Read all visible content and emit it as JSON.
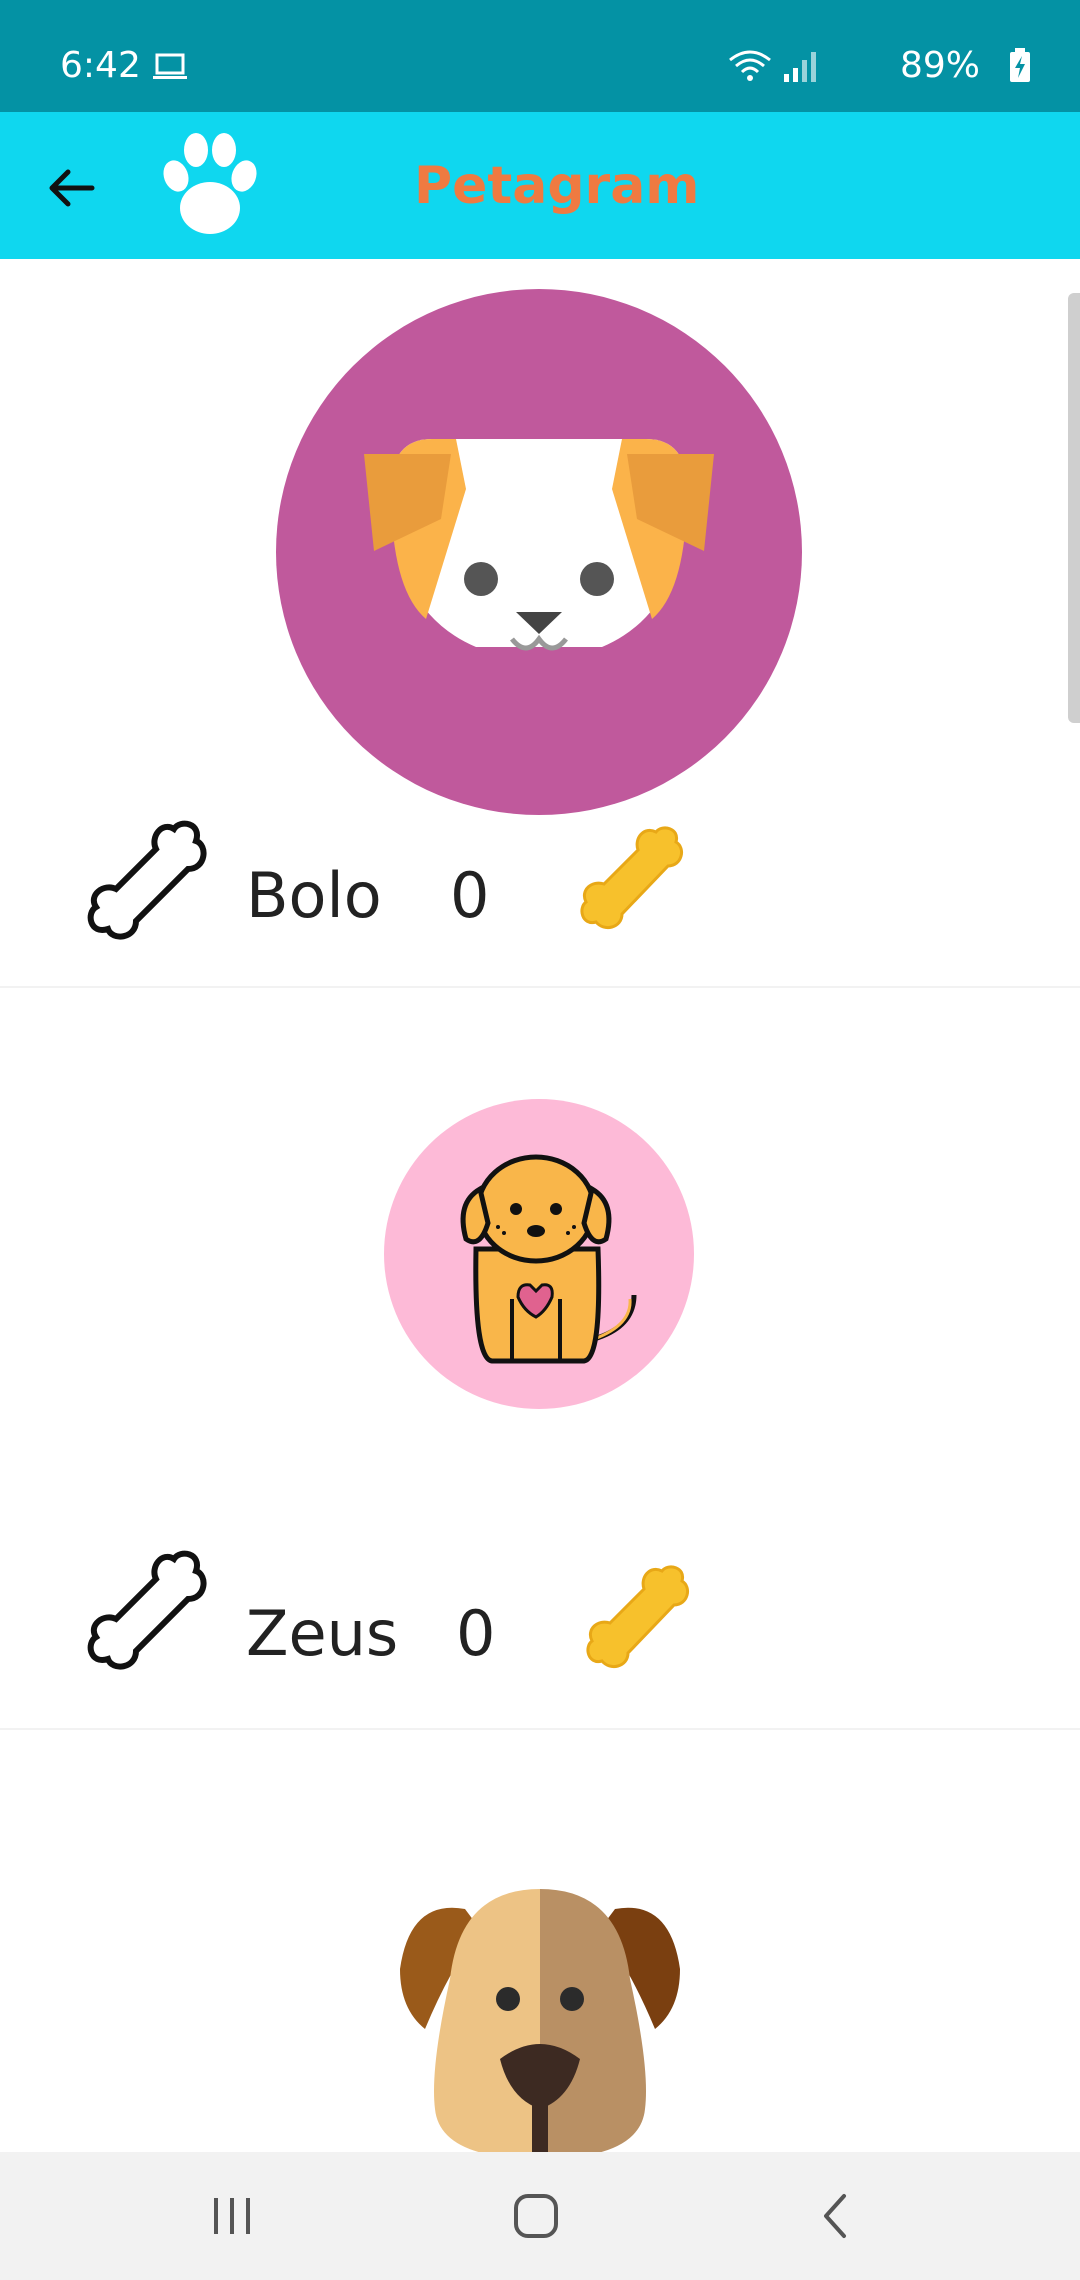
{
  "status_bar": {
    "time": "6:42",
    "battery_percent": "89%",
    "background_color": "#0492a4",
    "icons": [
      "laptop-icon",
      "wifi-icon",
      "signal-icon",
      "battery-charging-icon"
    ]
  },
  "app_bar": {
    "title": "Petagram",
    "background_color": "#0fd7ef",
    "title_color": "#ef7a41",
    "icons": [
      "back-arrow-icon",
      "paw-icon"
    ]
  },
  "pets": [
    {
      "name": "Bolo",
      "likes": "0",
      "photo": "dog-face-purple-circle"
    },
    {
      "name": "Zeus",
      "likes": "0",
      "photo": "puppy-pink-circle"
    },
    {
      "photo": "brown-dog-face"
    }
  ],
  "nav_bar": {
    "icons": [
      "recent-apps-icon",
      "home-icon",
      "back-icon"
    ]
  }
}
